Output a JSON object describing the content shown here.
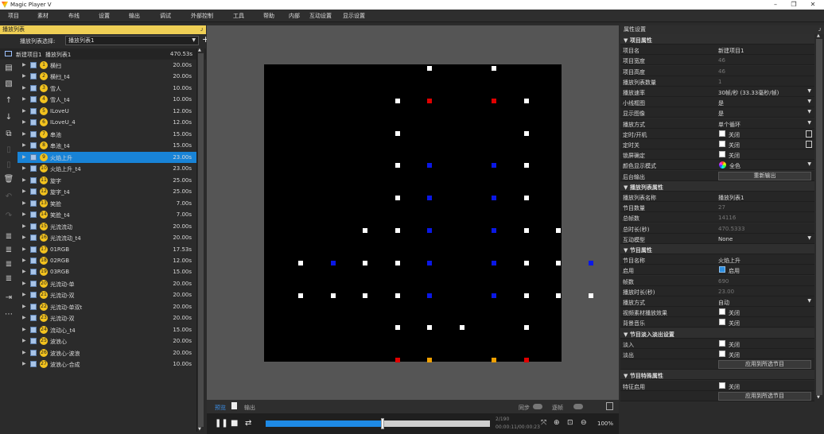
{
  "app": {
    "title": "Magic Player V"
  },
  "window_controls": {
    "minimize": "–",
    "maximize": "❐",
    "close": "✕"
  },
  "menu": [
    "项目",
    "素材",
    "布线",
    "设置",
    "输出",
    "调试",
    "外部控制",
    "工具",
    "帮助",
    "内部",
    "互动设置",
    "显示设置"
  ],
  "left_panel": {
    "title": "播放列表",
    "pin": "ᴊ",
    "select_label": "播放列表选择:",
    "select_value": "播放列表1",
    "project": {
      "name": "新建项目1",
      "playlist": "播放列表1",
      "duration": "470.53s"
    },
    "items": [
      {
        "num": "1",
        "name": "横扫",
        "duration": "20.00s"
      },
      {
        "num": "2",
        "name": "横扫_t4",
        "duration": "20.00s"
      },
      {
        "num": "3",
        "name": "雪人",
        "duration": "10.00s"
      },
      {
        "num": "4",
        "name": "雪人_t4",
        "duration": "10.00s"
      },
      {
        "num": "5",
        "name": "ILoveU",
        "duration": "12.00s"
      },
      {
        "num": "6",
        "name": "ILoveU_4",
        "duration": "12.00s"
      },
      {
        "num": "7",
        "name": "串池",
        "duration": "15.00s"
      },
      {
        "num": "8",
        "name": "串池_t4",
        "duration": "15.00s"
      },
      {
        "num": "9",
        "name": "火焰上升",
        "duration": "23.00s"
      },
      {
        "num": "10",
        "name": "火焰上升_t4",
        "duration": "23.00s"
      },
      {
        "num": "11",
        "name": "旋字",
        "duration": "25.00s"
      },
      {
        "num": "12",
        "name": "旋字_t4",
        "duration": "25.00s"
      },
      {
        "num": "13",
        "name": "笑脸",
        "duration": "7.00s"
      },
      {
        "num": "14",
        "name": "笑脸_t4",
        "duration": "7.00s"
      },
      {
        "num": "15",
        "name": "光流流动",
        "duration": "20.00s"
      },
      {
        "num": "16",
        "name": "光流流动_t4",
        "duration": "20.00s"
      },
      {
        "num": "17",
        "name": "01RGB",
        "duration": "17.53s"
      },
      {
        "num": "18",
        "name": "02RGB",
        "duration": "12.00s"
      },
      {
        "num": "19",
        "name": "03RGB",
        "duration": "15.00s"
      },
      {
        "num": "20",
        "name": "光流动-单",
        "duration": "20.00s"
      },
      {
        "num": "21",
        "name": "光流动-双",
        "duration": "20.00s"
      },
      {
        "num": "22",
        "name": "光流动-单双t",
        "duration": "20.00s"
      },
      {
        "num": "23",
        "name": "光流动-双",
        "duration": "20.00s"
      },
      {
        "num": "24",
        "name": "流动心_t4",
        "duration": "15.00s"
      },
      {
        "num": "25",
        "name": "波浪心",
        "duration": "20.00s"
      },
      {
        "num": "26",
        "name": "波浪心-波浪",
        "duration": "20.00s"
      },
      {
        "num": "27",
        "name": "波浪心-合成",
        "duration": "10.00s"
      }
    ],
    "selected_index": 8
  },
  "toolbar_icons": [
    "import-icon",
    "add-file-icon",
    "move-up-icon",
    "move-down-icon",
    "copy-icon",
    "paste-icon",
    "cut-icon",
    "delete-icon",
    "undo-icon",
    "redo-icon",
    "list-a-icon",
    "list-b-icon",
    "list-c-icon",
    "list-d-icon",
    "indent-icon",
    "more-icon"
  ],
  "bottom": {
    "tab_preview": "预览",
    "tab_output": "输出",
    "sync_label": "同步",
    "frames_label": "逐帧",
    "time1": "2/190",
    "time2": "00:00:11/00:00:23",
    "progress": 0.52,
    "zoom": "100%"
  },
  "right_panel": {
    "title": "属性设置",
    "pin": "ᴊ",
    "rows": [
      {
        "type": "section",
        "label": "▼ 项目属性"
      },
      {
        "k": "项目名",
        "v": "新建项目1"
      },
      {
        "k": "项目宽度",
        "v": "46",
        "dis": true
      },
      {
        "k": "项目高度",
        "v": "46",
        "dis": true
      },
      {
        "k": "播放列表数量",
        "v": "1",
        "dis": true
      },
      {
        "k": "播放速率",
        "v": "30帧/秒 (33.33毫秒/帧)",
        "dd": true
      },
      {
        "k": "小线框图",
        "v": "是",
        "dd": true
      },
      {
        "k": "显示图像",
        "v": "是",
        "dd": true
      },
      {
        "k": "播放方式",
        "v": "单个循环",
        "dd": true
      },
      {
        "k": "定时/开机",
        "chk": "关闭",
        "calc": true
      },
      {
        "k": "定时关",
        "chk": "关闭",
        "calc": true
      },
      {
        "k": "锁屏确定",
        "chk": "关闭"
      },
      {
        "k": "颜色显示模式",
        "color": "全色",
        "dd": true
      },
      {
        "k": "后台输出",
        "btn": "重新输出"
      },
      {
        "type": "section",
        "label": "▼ 播放列表属性"
      },
      {
        "k": "播放列表名称",
        "v": "播放列表1"
      },
      {
        "k": "节目数量",
        "v": "27",
        "dis": true
      },
      {
        "k": "总帧数",
        "v": "14116",
        "dis": true
      },
      {
        "k": "总时长(秒)",
        "v": "470.5333",
        "dis": true
      },
      {
        "k": "互动模型",
        "v": "None",
        "dd": true
      },
      {
        "type": "section",
        "label": "▼ 节目属性"
      },
      {
        "k": "节目名称",
        "v": "火焰上升"
      },
      {
        "k": "启用",
        "chk": "启用",
        "on": true
      },
      {
        "k": "帧数",
        "v": "690",
        "dis": true
      },
      {
        "k": "播放时长(秒)",
        "v": "23.00",
        "dis": true
      },
      {
        "k": "播放方式",
        "v": "自动",
        "dd": true
      },
      {
        "k": "视频素材播放效果",
        "chk": "关闭"
      },
      {
        "k": "背景音乐",
        "chk": "关闭"
      },
      {
        "type": "section",
        "label": "▼ 节目淡入淡出设置"
      },
      {
        "k": "淡入",
        "chk": "关闭"
      },
      {
        "k": "淡出",
        "chk": "关闭"
      },
      {
        "k": "",
        "btn": "应用到所选节目"
      },
      {
        "type": "section",
        "label": "▼ 节目特殊属性"
      },
      {
        "k": "特征启用",
        "chk": "关闭"
      },
      {
        "k": "",
        "btn": "应用到所选节目"
      }
    ]
  },
  "preview": {
    "colors": {
      "w": "#ffffff",
      "r": "#e00000",
      "b": "#0a18e6",
      "y": "#f0a000"
    },
    "grid": [
      "....w.w....",
      "...........",
      "...wr.rw...",
      "...........",
      "...w...w...",
      "...........",
      "...wb.bw...",
      "...........",
      "...wb.bw...",
      "...........",
      "..wwb.bww..",
      "...........",
      "wbwwb.bwwbw",
      "...........",
      "wwwwb.bwwww",
      "...........",
      "...www.w...",
      "...........",
      "...ry.yr..."
    ]
  }
}
